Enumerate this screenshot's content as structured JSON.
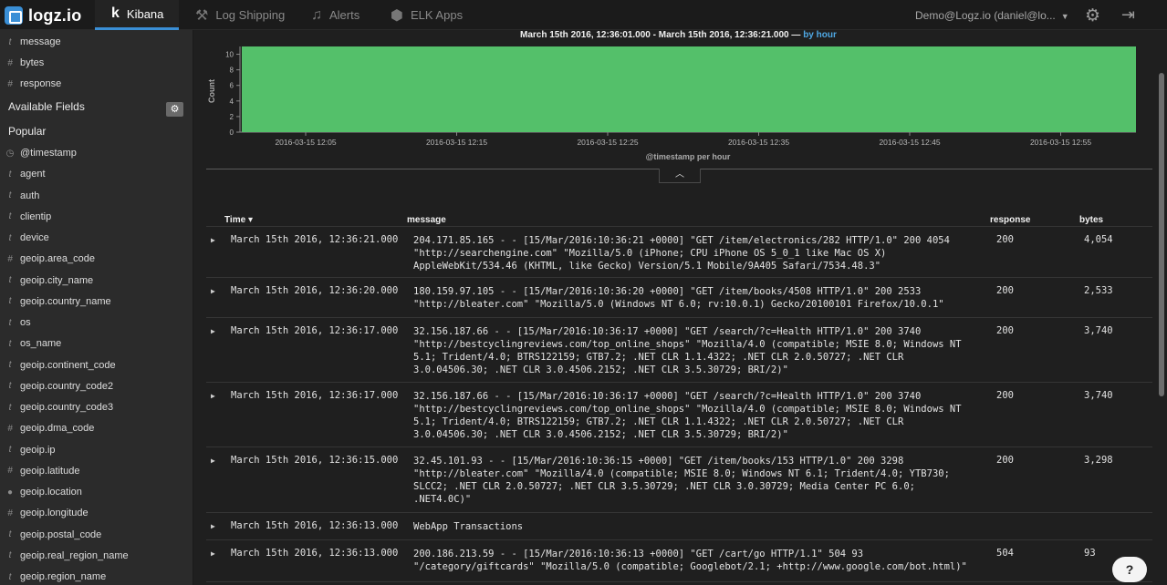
{
  "app": {
    "brand": "logz.io",
    "user": "Demo@Logz.io (daniel@lo..."
  },
  "nav": {
    "kibana": "Kibana",
    "log_shipping": "Log Shipping",
    "alerts": "Alerts",
    "elk_apps": "ELK Apps"
  },
  "sidebar": {
    "selected": [
      {
        "type": "t",
        "name": "message"
      },
      {
        "type": "#",
        "name": "bytes"
      },
      {
        "type": "#",
        "name": "response"
      }
    ],
    "available_title": "Available Fields",
    "popular_title": "Popular",
    "fields": [
      {
        "type": "◷",
        "name": "@timestamp"
      },
      {
        "type": "t",
        "name": "agent"
      },
      {
        "type": "t",
        "name": "auth"
      },
      {
        "type": "t",
        "name": "clientip"
      },
      {
        "type": "t",
        "name": "device"
      },
      {
        "type": "#",
        "name": "geoip.area_code"
      },
      {
        "type": "t",
        "name": "geoip.city_name"
      },
      {
        "type": "t",
        "name": "geoip.country_name"
      },
      {
        "type": "t",
        "name": "os"
      },
      {
        "type": "t",
        "name": "os_name"
      },
      {
        "type": "t",
        "name": "geoip.continent_code"
      },
      {
        "type": "t",
        "name": "geoip.country_code2"
      },
      {
        "type": "t",
        "name": "geoip.country_code3"
      },
      {
        "type": "#",
        "name": "geoip.dma_code"
      },
      {
        "type": "t",
        "name": "geoip.ip"
      },
      {
        "type": "#",
        "name": "geoip.latitude"
      },
      {
        "type": "●",
        "name": "geoip.location"
      },
      {
        "type": "#",
        "name": "geoip.longitude"
      },
      {
        "type": "t",
        "name": "geoip.postal_code"
      },
      {
        "type": "t",
        "name": "geoip.real_region_name"
      },
      {
        "type": "t",
        "name": "geoip.region_name"
      }
    ]
  },
  "histogram": {
    "range": "March 15th 2016, 12:36:01.000 - March 15th 2016, 12:36:21.000 —",
    "interval": "by hour"
  },
  "chart_data": {
    "type": "bar",
    "title": "",
    "xlabel": "@timestamp per hour",
    "ylabel": "Count",
    "ylim": [
      0,
      11
    ],
    "yticks": [
      0,
      2,
      4,
      6,
      8,
      10
    ],
    "xticks": [
      "2016-03-15 12:05",
      "2016-03-15 12:15",
      "2016-03-15 12:25",
      "2016-03-15 12:35",
      "2016-03-15 12:45",
      "2016-03-15 12:55"
    ],
    "values": [
      11
    ],
    "color": "#54c06a"
  },
  "table": {
    "headers": {
      "time": "Time",
      "message": "message",
      "response": "response",
      "bytes": "bytes"
    },
    "rows": [
      {
        "time": "March 15th 2016, 12:36:21.000",
        "message": "204.171.85.165 - - [15/Mar/2016:10:36:21 +0000] \"GET /item/electronics/282 HTTP/1.0\" 200 4054\n\"http://searchengine.com\" \"Mozilla/5.0 (iPhone; CPU iPhone OS 5_0_1 like Mac OS X)\nAppleWebKit/534.46 (KHTML, like Gecko) Version/5.1 Mobile/9A405 Safari/7534.48.3\"",
        "response": "200",
        "bytes": "4,054"
      },
      {
        "time": "March 15th 2016, 12:36:20.000",
        "message": "180.159.97.105 - - [15/Mar/2016:10:36:20 +0000] \"GET /item/books/4508 HTTP/1.0\" 200 2533\n\"http://bleater.com\" \"Mozilla/5.0 (Windows NT 6.0; rv:10.0.1) Gecko/20100101 Firefox/10.0.1\"",
        "response": "200",
        "bytes": "2,533"
      },
      {
        "time": "March 15th 2016, 12:36:17.000",
        "message": "32.156.187.66 - - [15/Mar/2016:10:36:17 +0000] \"GET /search/?c=Health HTTP/1.0\" 200 3740\n\"http://bestcyclingreviews.com/top_online_shops\" \"Mozilla/4.0 (compatible; MSIE 8.0; Windows NT\n5.1; Trident/4.0; BTRS122159; GTB7.2; .NET CLR 1.1.4322; .NET CLR 2.0.50727; .NET CLR\n3.0.04506.30; .NET CLR 3.0.4506.2152; .NET CLR 3.5.30729; BRI/2)\"",
        "response": "200",
        "bytes": "3,740"
      },
      {
        "time": "March 15th 2016, 12:36:17.000",
        "message": "32.156.187.66 - - [15/Mar/2016:10:36:17 +0000] \"GET /search/?c=Health HTTP/1.0\" 200 3740\n\"http://bestcyclingreviews.com/top_online_shops\" \"Mozilla/4.0 (compatible; MSIE 8.0; Windows NT\n5.1; Trident/4.0; BTRS122159; GTB7.2; .NET CLR 1.1.4322; .NET CLR 2.0.50727; .NET CLR\n3.0.04506.30; .NET CLR 3.0.4506.2152; .NET CLR 3.5.30729; BRI/2)\"",
        "response": "200",
        "bytes": "3,740"
      },
      {
        "time": "March 15th 2016, 12:36:15.000",
        "message": "32.45.101.93 - - [15/Mar/2016:10:36:15 +0000] \"GET /item/books/153 HTTP/1.0\" 200 3298\n\"http://bleater.com\" \"Mozilla/4.0 (compatible; MSIE 8.0; Windows NT 6.1; Trident/4.0; YTB730;\nSLCC2; .NET CLR 2.0.50727; .NET CLR 3.5.30729; .NET CLR 3.0.30729; Media Center PC 6.0;\n.NET4.0C)\"",
        "response": "200",
        "bytes": "3,298"
      },
      {
        "time": "March 15th 2016, 12:36:13.000",
        "message": "WebApp Transactions",
        "response": "",
        "bytes": ""
      },
      {
        "time": "March 15th 2016, 12:36:13.000",
        "message": "200.186.213.59 - - [15/Mar/2016:10:36:13 +0000] \"GET /cart/go HTTP/1.1\" 504 93\n\"/category/giftcards\" \"Mozilla/5.0 (compatible; Googlebot/2.1; +http://www.google.com/bot.html)\"",
        "response": "504",
        "bytes": "93"
      }
    ]
  },
  "help_label": "?"
}
